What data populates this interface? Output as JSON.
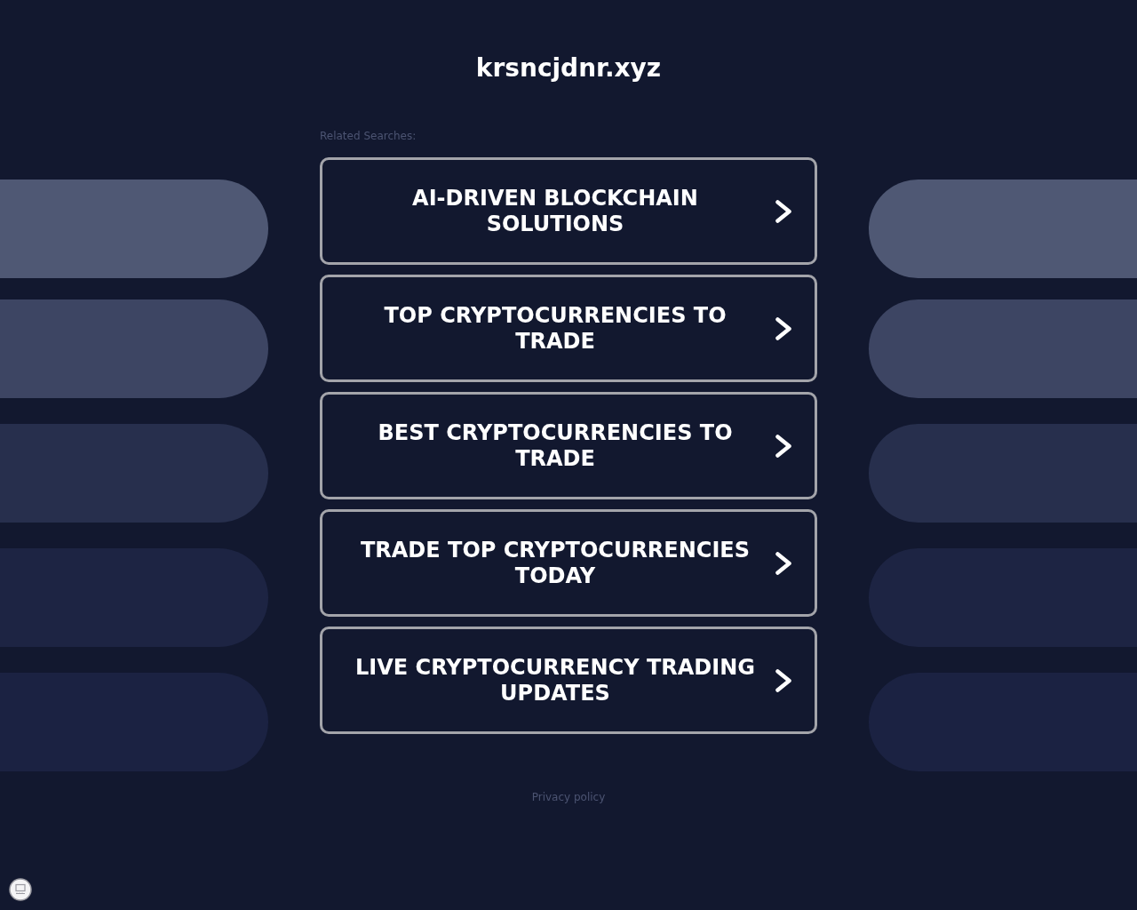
{
  "header": {
    "title": "krsncjdnr.xyz"
  },
  "related": {
    "heading": "Related Searches:",
    "links": [
      {
        "label": "AI-DRIVEN BLOCKCHAIN SOLUTIONS"
      },
      {
        "label": "TOP CRYPTOCURRENCIES TO TRADE"
      },
      {
        "label": "BEST CRYPTOCURRENCIES TO TRADE"
      },
      {
        "label": "TRADE TOP CRYPTOCURRENCIES TODAY"
      },
      {
        "label": "LIVE CRYPTOCURRENCY TRADING UPDATES"
      }
    ]
  },
  "footer": {
    "privacy_link": "Privacy policy"
  }
}
